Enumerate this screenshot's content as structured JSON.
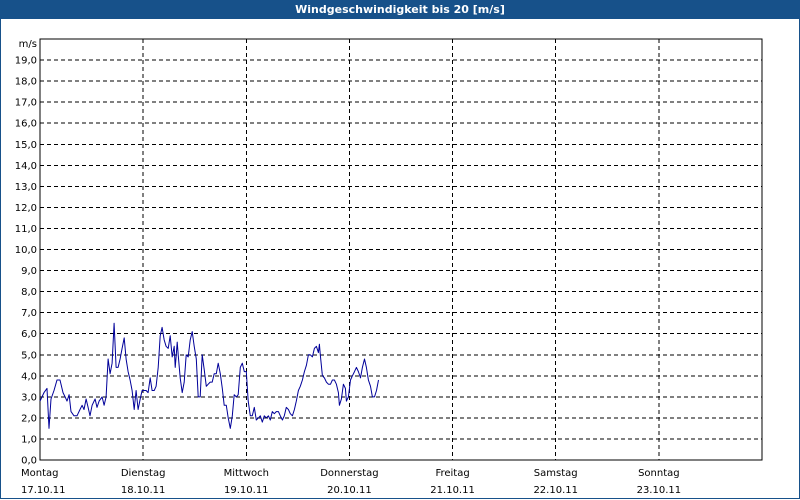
{
  "header": {
    "title": "Windgeschwindigkeit bis 20 [m/s]"
  },
  "colors": {
    "title_bar": "#17518a",
    "series": "#000099",
    "grid": "#000000",
    "background": "#ffffff"
  },
  "chart_data": {
    "type": "line",
    "title": "Windgeschwindigkeit bis 20 [m/s]",
    "ylabel": "m/s",
    "xlabel": "",
    "ylim": [
      0,
      20
    ],
    "xlim": [
      0,
      7
    ],
    "grid": true,
    "y_ticks": [
      "0,0",
      "1,0",
      "2,0",
      "3,0",
      "4,0",
      "5,0",
      "6,0",
      "7,0",
      "8,0",
      "9,0",
      "10,0",
      "11,0",
      "12,0",
      "13,0",
      "14,0",
      "15,0",
      "16,0",
      "17,0",
      "18,0",
      "19,0"
    ],
    "x_ticks": [
      {
        "day": "Montag",
        "date": "17.10.11"
      },
      {
        "day": "Dienstag",
        "date": "18.10.11"
      },
      {
        "day": "Mittwoch",
        "date": "19.10.11"
      },
      {
        "day": "Donnerstag",
        "date": "20.10.11"
      },
      {
        "day": "Freitag",
        "date": "21.10.11"
      },
      {
        "day": "Samstag",
        "date": "22.10.11"
      },
      {
        "day": "Sonntag",
        "date": "23.10.11"
      }
    ],
    "series": [
      {
        "values": [
          [
            0.0,
            2.8
          ],
          [
            0.039,
            3.2
          ],
          [
            0.068,
            3.4
          ],
          [
            0.087,
            1.5
          ],
          [
            0.107,
            2.9
          ],
          [
            0.136,
            3.3
          ],
          [
            0.165,
            3.8
          ],
          [
            0.194,
            3.8
          ],
          [
            0.223,
            3.2
          ],
          [
            0.243,
            3.0
          ],
          [
            0.262,
            2.8
          ],
          [
            0.282,
            3.1
          ],
          [
            0.301,
            2.3
          ],
          [
            0.33,
            2.1
          ],
          [
            0.359,
            2.1
          ],
          [
            0.388,
            2.4
          ],
          [
            0.408,
            2.6
          ],
          [
            0.427,
            2.4
          ],
          [
            0.447,
            2.9
          ],
          [
            0.466,
            2.5
          ],
          [
            0.485,
            2.1
          ],
          [
            0.505,
            2.6
          ],
          [
            0.534,
            2.9
          ],
          [
            0.553,
            2.5
          ],
          [
            0.573,
            2.8
          ],
          [
            0.602,
            3.0
          ],
          [
            0.621,
            2.6
          ],
          [
            0.641,
            3.0
          ],
          [
            0.66,
            4.8
          ],
          [
            0.68,
            4.1
          ],
          [
            0.699,
            4.6
          ],
          [
            0.718,
            6.5
          ],
          [
            0.738,
            4.4
          ],
          [
            0.757,
            4.4
          ],
          [
            0.777,
            4.8
          ],
          [
            0.796,
            5.3
          ],
          [
            0.816,
            5.8
          ],
          [
            0.835,
            4.8
          ],
          [
            0.854,
            4.2
          ],
          [
            0.874,
            3.8
          ],
          [
            0.893,
            3.3
          ],
          [
            0.913,
            2.4
          ],
          [
            0.932,
            3.3
          ],
          [
            0.951,
            2.4
          ],
          [
            0.971,
            2.9
          ],
          [
            0.99,
            3.3
          ],
          [
            1.01,
            3.3
          ],
          [
            1.029,
            3.3
          ],
          [
            1.048,
            3.2
          ],
          [
            1.068,
            3.9
          ],
          [
            1.087,
            3.3
          ],
          [
            1.107,
            3.3
          ],
          [
            1.126,
            3.5
          ],
          [
            1.146,
            4.4
          ],
          [
            1.165,
            5.9
          ],
          [
            1.184,
            6.3
          ],
          [
            1.204,
            5.7
          ],
          [
            1.223,
            5.4
          ],
          [
            1.243,
            5.3
          ],
          [
            1.262,
            5.9
          ],
          [
            1.282,
            4.9
          ],
          [
            1.301,
            5.4
          ],
          [
            1.311,
            4.4
          ],
          [
            1.32,
            4.9
          ],
          [
            1.33,
            5.6
          ],
          [
            1.34,
            5.0
          ],
          [
            1.359,
            3.9
          ],
          [
            1.379,
            3.2
          ],
          [
            1.398,
            3.7
          ],
          [
            1.417,
            5.0
          ],
          [
            1.437,
            4.9
          ],
          [
            1.456,
            5.7
          ],
          [
            1.476,
            6.1
          ],
          [
            1.495,
            5.4
          ],
          [
            1.515,
            4.8
          ],
          [
            1.534,
            3.0
          ],
          [
            1.553,
            3.0
          ],
          [
            1.573,
            5.0
          ],
          [
            1.592,
            4.3
          ],
          [
            1.612,
            3.5
          ],
          [
            1.631,
            3.6
          ],
          [
            1.65,
            3.7
          ],
          [
            1.67,
            3.7
          ],
          [
            1.689,
            4.1
          ],
          [
            1.709,
            4.1
          ],
          [
            1.728,
            4.6
          ],
          [
            1.748,
            4.1
          ],
          [
            1.767,
            3.4
          ],
          [
            1.786,
            2.6
          ],
          [
            1.806,
            2.6
          ],
          [
            1.825,
            2.0
          ],
          [
            1.845,
            1.5
          ],
          [
            1.864,
            2.1
          ],
          [
            1.883,
            3.1
          ],
          [
            1.903,
            3.0
          ],
          [
            1.922,
            3.1
          ],
          [
            1.942,
            4.4
          ],
          [
            1.961,
            4.6
          ],
          [
            1.981,
            4.2
          ],
          [
            2.0,
            4.2
          ],
          [
            2.019,
            2.8
          ],
          [
            2.039,
            2.1
          ],
          [
            2.058,
            2.1
          ],
          [
            2.078,
            2.5
          ],
          [
            2.097,
            1.9
          ],
          [
            2.117,
            2.0
          ],
          [
            2.136,
            2.1
          ],
          [
            2.155,
            1.8
          ],
          [
            2.175,
            2.1
          ],
          [
            2.194,
            2.0
          ],
          [
            2.214,
            2.1
          ],
          [
            2.233,
            1.9
          ],
          [
            2.252,
            2.3
          ],
          [
            2.272,
            2.2
          ],
          [
            2.291,
            2.3
          ],
          [
            2.311,
            2.3
          ],
          [
            2.33,
            2.1
          ],
          [
            2.35,
            1.9
          ],
          [
            2.369,
            2.1
          ],
          [
            2.388,
            2.5
          ],
          [
            2.408,
            2.4
          ],
          [
            2.427,
            2.2
          ],
          [
            2.447,
            2.1
          ],
          [
            2.466,
            2.4
          ],
          [
            2.485,
            2.8
          ],
          [
            2.505,
            3.3
          ],
          [
            2.524,
            3.5
          ],
          [
            2.544,
            3.8
          ],
          [
            2.563,
            4.2
          ],
          [
            2.583,
            4.5
          ],
          [
            2.602,
            5.0
          ],
          [
            2.621,
            5.0
          ],
          [
            2.641,
            4.9
          ],
          [
            2.66,
            5.3
          ],
          [
            2.68,
            5.4
          ],
          [
            2.699,
            5.1
          ],
          [
            2.709,
            5.5
          ],
          [
            2.718,
            5.0
          ],
          [
            2.738,
            4.0
          ],
          [
            2.757,
            3.9
          ],
          [
            2.777,
            3.7
          ],
          [
            2.796,
            3.6
          ],
          [
            2.816,
            3.6
          ],
          [
            2.835,
            3.8
          ],
          [
            2.854,
            3.8
          ],
          [
            2.874,
            3.6
          ],
          [
            2.893,
            3.2
          ],
          [
            2.903,
            2.6
          ],
          [
            2.922,
            2.9
          ],
          [
            2.942,
            3.6
          ],
          [
            2.961,
            3.4
          ],
          [
            2.971,
            2.8
          ],
          [
            2.99,
            3.0
          ],
          [
            3.01,
            3.8
          ],
          [
            3.029,
            4.0
          ],
          [
            3.049,
            4.2
          ],
          [
            3.068,
            4.4
          ],
          [
            3.087,
            4.2
          ],
          [
            3.107,
            3.9
          ],
          [
            3.126,
            4.4
          ],
          [
            3.146,
            4.8
          ],
          [
            3.165,
            4.4
          ],
          [
            3.184,
            3.8
          ],
          [
            3.204,
            3.5
          ],
          [
            3.223,
            3.0
          ],
          [
            3.243,
            3.0
          ],
          [
            3.262,
            3.3
          ],
          [
            3.282,
            3.8
          ]
        ]
      }
    ]
  }
}
